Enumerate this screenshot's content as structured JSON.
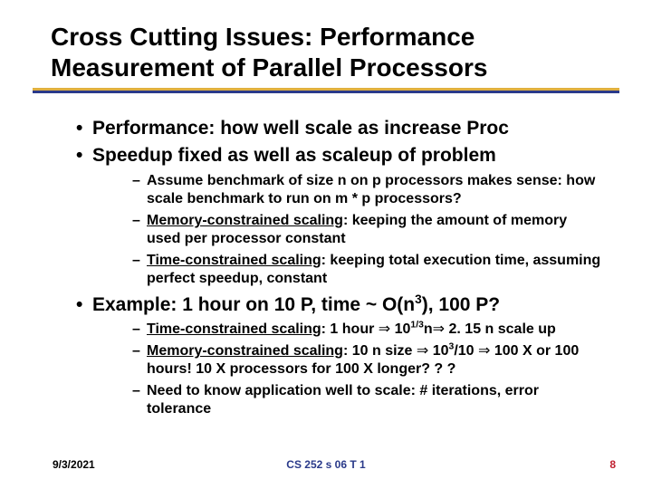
{
  "title_l1": "Cross Cutting Issues: Performance",
  "title_l2": "Measurement of Parallel Processors",
  "b1": "Performance: how well scale as increase Proc",
  "b2": "Speedup fixed as well as scaleup of problem",
  "b2a": "Assume benchmark of size n on p processors makes sense: how scale benchmark to run on m * p processors?",
  "b2b_term": "Memory-constrained scaling",
  "b2b_rest": ": keeping the amount of memory used per processor constant",
  "b2c_term": "Time-constrained scaling",
  "b2c_rest": ": keeping total execution time, assuming perfect speedup, constant",
  "b3_pre": "Example: 1 hour on 10 P, time ~ O(n",
  "b3_sup": "3",
  "b3_post": "), 100 P?",
  "b3a_term": "Time-constrained scaling",
  "b3a_mid1": ": 1 hour ",
  "b3a_val1_pre": " 10",
  "b3a_val1_sup": "1/3",
  "b3a_val1_post": "n",
  "b3a_mid2": " 2. 15 n scale up",
  "b3b_term": "Memory-constrained scaling",
  "b3b_mid1": ": 10 n size ",
  "b3b_val1": " 10",
  "b3b_sup": "3",
  "b3b_val1b": "/10 ",
  "b3b_rest": " 100 X or 100 hours! 10 X processors for 100 X longer? ? ?",
  "b3c": "Need to know application well to scale: # iterations, error tolerance",
  "arrow": "⇒",
  "footer_date": "9/3/2021",
  "footer_course": "CS 252 s 06 T 1",
  "footer_page": "8"
}
